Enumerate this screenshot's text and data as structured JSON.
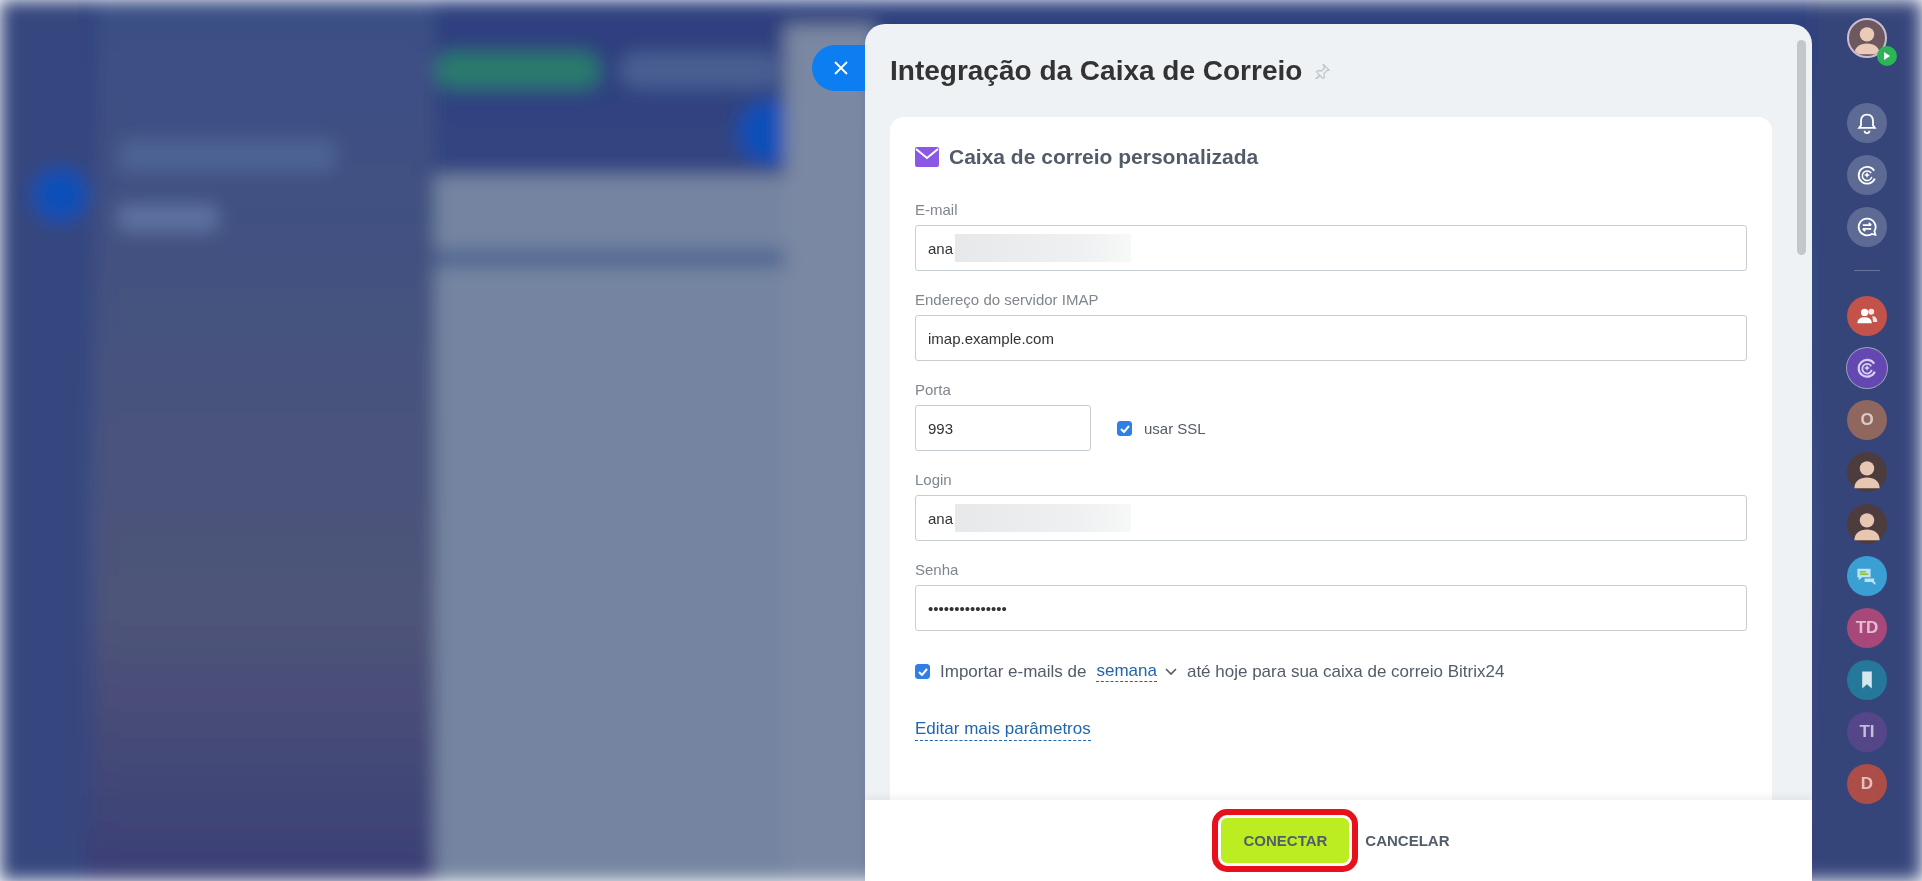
{
  "panel": {
    "title": "Integração da Caixa de Correio",
    "section_title": "Caixa de correio personalizada",
    "fields": [
      {
        "kind": "text",
        "label": "E-mail",
        "value": "ana",
        "redacted": true
      },
      {
        "kind": "text",
        "label": "Endereço do servidor IMAP",
        "value": "imap.example.com",
        "redacted": false
      },
      {
        "kind": "port",
        "label": "Porta",
        "value": "993",
        "option": {
          "label": "usar SSL",
          "checked": true
        }
      },
      {
        "kind": "text",
        "label": "Login",
        "value": "ana",
        "redacted": true
      },
      {
        "kind": "text",
        "label": "Senha",
        "value": "•••••••••••••••",
        "redacted": false
      }
    ],
    "import": {
      "checked": true,
      "prefix": "Importar e-mails de",
      "period": "semana",
      "suffix": "até hoje para sua caixa de correio Bitrix24"
    },
    "more_link": "Editar mais parâmetros",
    "buttons": [
      {
        "kind": "primary",
        "label": "CONECTAR",
        "highlighted": true
      },
      {
        "kind": "link",
        "label": "CANCELAR",
        "highlighted": false
      }
    ]
  },
  "right_bar": {
    "items": [
      {
        "kind": "user",
        "badge": true
      },
      {
        "kind": "bell"
      },
      {
        "kind": "copilot"
      },
      {
        "kind": "swap-chat"
      },
      {
        "kind": "divider"
      },
      {
        "kind": "group",
        "color": "#c2524a"
      },
      {
        "kind": "copilot-round",
        "color": "#6447b0"
      },
      {
        "kind": "initials",
        "text": "O",
        "color": "#8f675e"
      },
      {
        "kind": "person"
      },
      {
        "kind": "person"
      },
      {
        "kind": "chat",
        "color": "#3a9fd3"
      },
      {
        "kind": "initials",
        "text": "TD",
        "color": "#a8487a"
      },
      {
        "kind": "bookmark",
        "color": "#25789a"
      },
      {
        "kind": "initials",
        "text": "TI",
        "color": "#55468a"
      },
      {
        "kind": "initials",
        "text": "D",
        "color": "#ad4d48"
      }
    ]
  }
}
